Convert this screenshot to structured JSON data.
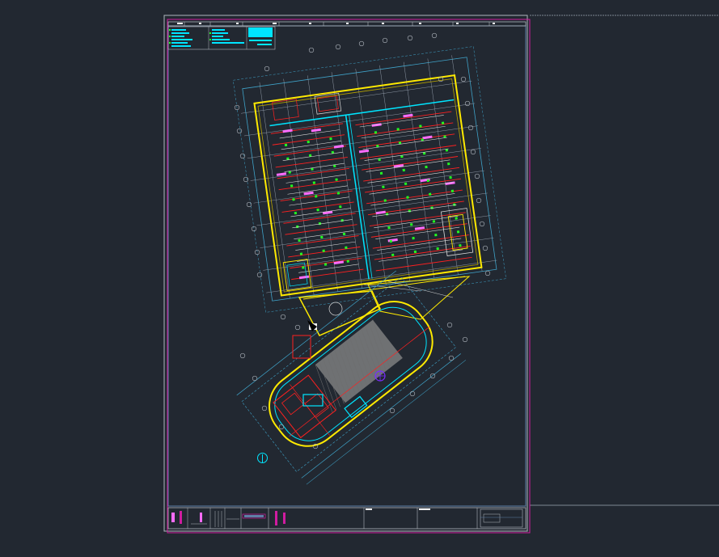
{
  "drawing": {
    "background": "#222831",
    "colors": {
      "sheet_border": "#b0b6be",
      "magenta": "#d01ca0",
      "cyan": "#00e5ff",
      "yellow": "#ffea00",
      "red": "#ff2020",
      "green": "#22ff22",
      "pink": "#ff6cff",
      "gray_fill": "#8a8a8a",
      "dim_line": "#3fa2c8",
      "white": "#f0f0f0",
      "blue": "#3b5bff"
    },
    "icons": {
      "north_arrow": "compass-icon"
    }
  }
}
